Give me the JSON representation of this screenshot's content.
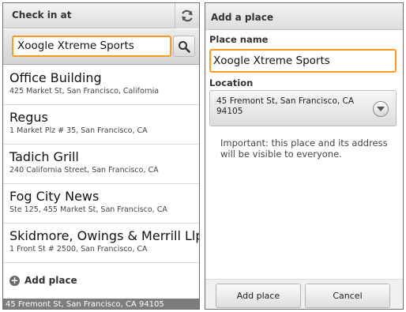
{
  "left": {
    "header": {
      "title": "Check in at"
    },
    "icons": {
      "refresh": "refresh-icon",
      "search": "search-icon",
      "add": "plus-circle-icon"
    },
    "search": {
      "value": "Xoogle Xtreme Sports"
    },
    "places": [
      {
        "name": "Office Building",
        "address": "425 Market St, San Francisco, California"
      },
      {
        "name": "Regus",
        "address": "1 Market Plz # 35, San Francisco, CA"
      },
      {
        "name": "Tadich Grill",
        "address": "240 California Street, San Francisco, CA"
      },
      {
        "name": "Fog City News",
        "address": "Ste 125, 455 Market St, San Francisco, CA"
      },
      {
        "name": "Skidmore, Owings & Merrill Llp",
        "address": "1 Front St # 2500, San Francisco, CA"
      }
    ],
    "add_place": {
      "label": "Add place"
    },
    "footer": {
      "location": "45 Fremont St, San Francisco, CA 94105"
    }
  },
  "right": {
    "header": {
      "title": "Add a place"
    },
    "place_name": {
      "label": "Place name",
      "value": "Xoogle Xtreme Sports"
    },
    "location": {
      "label": "Location",
      "value": "45 Fremont St, San Francisco, CA 94105"
    },
    "notice": "Important: this place and its address will be visible to everyone.",
    "buttons": {
      "add": "Add place",
      "cancel": "Cancel"
    }
  },
  "colors": {
    "accent_focus": "#ff9a1f",
    "footer_bg": "#7d7d7d"
  }
}
